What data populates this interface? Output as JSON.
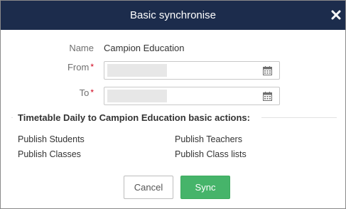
{
  "dialog": {
    "title": "Basic synchronise",
    "close_icon": "close-icon"
  },
  "form": {
    "name_label": "Name",
    "name_value": "Campion Education",
    "from_label": "From",
    "to_label": "To",
    "required_marker": "*",
    "calendar_icon": "calendar-icon"
  },
  "actions_section": {
    "title": "Timetable Daily to Campion Education basic actions:",
    "items": [
      "Publish Students",
      "Publish Teachers",
      "Publish Classes",
      "Publish Class lists"
    ]
  },
  "buttons": {
    "cancel_label": "Cancel",
    "sync_label": "Sync"
  },
  "colors": {
    "titlebar": "#1c2c4c",
    "sync_button": "#46b46a",
    "required": "#d0021b"
  }
}
